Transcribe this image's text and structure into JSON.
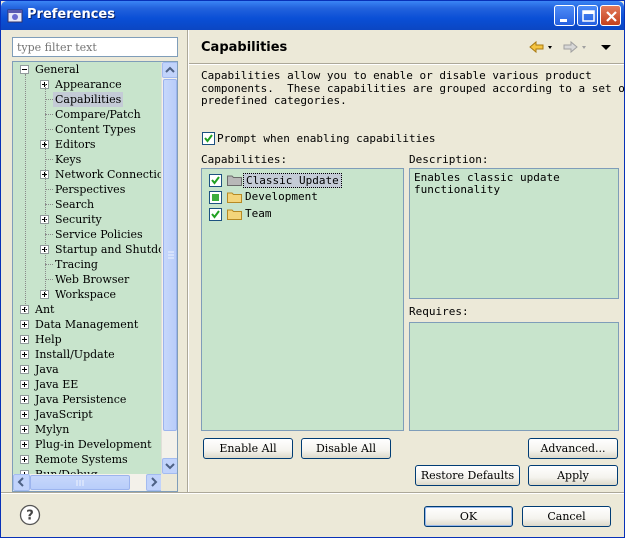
{
  "window": {
    "title": "Preferences"
  },
  "filter": {
    "placeholder": "type filter text"
  },
  "tree": {
    "items": [
      {
        "label": "General",
        "expander": "minus",
        "level": 0
      },
      {
        "label": "Appearance",
        "expander": "plus",
        "level": 1
      },
      {
        "label": "Capabilities",
        "expander": "none",
        "level": 1,
        "selected": true
      },
      {
        "label": "Compare/Patch",
        "expander": "none",
        "level": 1
      },
      {
        "label": "Content Types",
        "expander": "none",
        "level": 1
      },
      {
        "label": "Editors",
        "expander": "plus",
        "level": 1
      },
      {
        "label": "Keys",
        "expander": "none",
        "level": 1
      },
      {
        "label": "Network Connections",
        "expander": "plus",
        "level": 1
      },
      {
        "label": "Perspectives",
        "expander": "none",
        "level": 1
      },
      {
        "label": "Search",
        "expander": "none",
        "level": 1
      },
      {
        "label": "Security",
        "expander": "plus",
        "level": 1
      },
      {
        "label": "Service Policies",
        "expander": "none",
        "level": 1
      },
      {
        "label": "Startup and Shutdown",
        "expander": "plus",
        "level": 1
      },
      {
        "label": "Tracing",
        "expander": "none",
        "level": 1
      },
      {
        "label": "Web Browser",
        "expander": "none",
        "level": 1
      },
      {
        "label": "Workspace",
        "expander": "plus",
        "level": 1
      },
      {
        "label": "Ant",
        "expander": "plus",
        "level": 0
      },
      {
        "label": "Data Management",
        "expander": "plus",
        "level": 0
      },
      {
        "label": "Help",
        "expander": "plus",
        "level": 0
      },
      {
        "label": "Install/Update",
        "expander": "plus",
        "level": 0
      },
      {
        "label": "Java",
        "expander": "plus",
        "level": 0
      },
      {
        "label": "Java EE",
        "expander": "plus",
        "level": 0
      },
      {
        "label": "Java Persistence",
        "expander": "plus",
        "level": 0
      },
      {
        "label": "JavaScript",
        "expander": "plus",
        "level": 0
      },
      {
        "label": "Mylyn",
        "expander": "plus",
        "level": 0
      },
      {
        "label": "Plug-in Development",
        "expander": "plus",
        "level": 0
      },
      {
        "label": "Remote Systems",
        "expander": "plus",
        "level": 0
      },
      {
        "label": "Run/Debug",
        "expander": "plus",
        "level": 0
      }
    ]
  },
  "page": {
    "title": "Capabilities",
    "description": "Capabilities allow you to enable or disable various product\ncomponents.  These capabilities are grouped according to a set of\npredefined categories.",
    "prompt_label": "Prompt when enabling capabilities",
    "prompt_checked": true,
    "capabilities_label": "Capabilities:",
    "description_label": "Description:",
    "requires_label": "Requires:",
    "capabilities": [
      {
        "label": "Classic Update",
        "state": "checked",
        "selected": true
      },
      {
        "label": "Development",
        "state": "partial"
      },
      {
        "label": "Team",
        "state": "checked"
      }
    ],
    "description_text": "Enables classic update\nfunctionality",
    "buttons": {
      "enable_all": "Enable All",
      "disable_all": "Disable All",
      "advanced": "Advanced...",
      "restore_defaults": "Restore Defaults",
      "apply": "Apply"
    }
  },
  "footer": {
    "ok": "OK",
    "cancel": "Cancel"
  },
  "colors": {
    "panel_bg": "#c8e4cc",
    "titlebar": "#0a4fd6",
    "selection": "#c4cbd6"
  },
  "icons": [
    "app-icon",
    "minimize-icon",
    "maximize-icon",
    "close-icon",
    "back-arrow-icon",
    "forward-arrow-icon",
    "view-menu-icon",
    "folder-icon",
    "help-icon"
  ]
}
